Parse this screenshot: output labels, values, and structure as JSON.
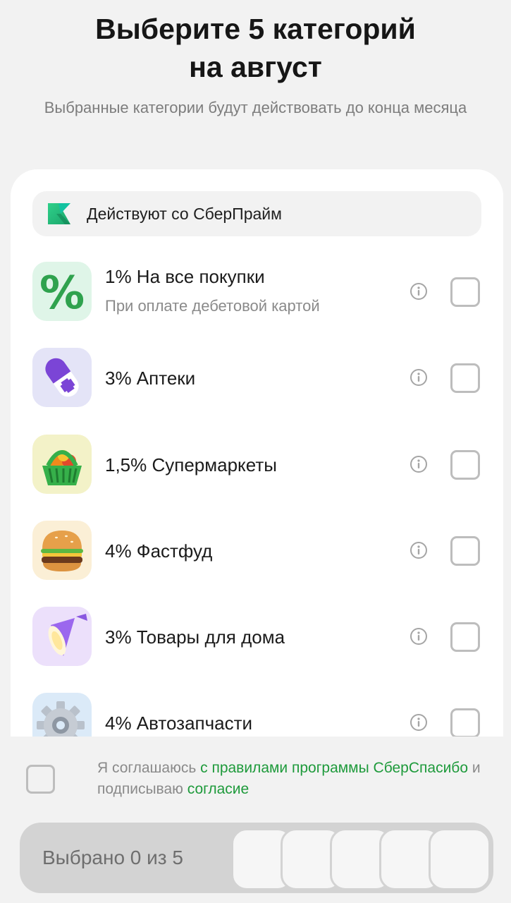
{
  "header": {
    "title_line1": "Выберите 5 категорий",
    "title_line2": "на август",
    "subtitle": "Выбранные категории будут действовать до конца месяца"
  },
  "prime_banner": {
    "label": "Действуют со СберПрайм",
    "icon": "sberprime-logo"
  },
  "categories": [
    {
      "title": "1% На все покупки",
      "subtitle": "При оплате дебетовой картой",
      "icon": "percent-icon",
      "checked": false
    },
    {
      "title": "3% Аптеки",
      "icon": "pill-icon",
      "checked": false
    },
    {
      "title": "1,5% Супермаркеты",
      "icon": "basket-icon",
      "checked": false
    },
    {
      "title": "4% Фастфуд",
      "icon": "burger-icon",
      "checked": false
    },
    {
      "title": "3% Товары для дома",
      "icon": "lamp-icon",
      "checked": false
    },
    {
      "title": "4% Автозапчасти",
      "icon": "gear-icon",
      "checked": false
    }
  ],
  "agreement": {
    "text_1": "Я соглашаюсь ",
    "link_1": "с правилами программы СберСпасибо",
    "text_2": " и подписываю ",
    "link_2": "согласие",
    "checked": false
  },
  "selection": {
    "label": "Выбрано 0 из 5",
    "selected": 0,
    "max": 5
  },
  "colors": {
    "accent_green": "#1e9a3b",
    "background": "#f2f2f2",
    "card": "#ffffff"
  }
}
